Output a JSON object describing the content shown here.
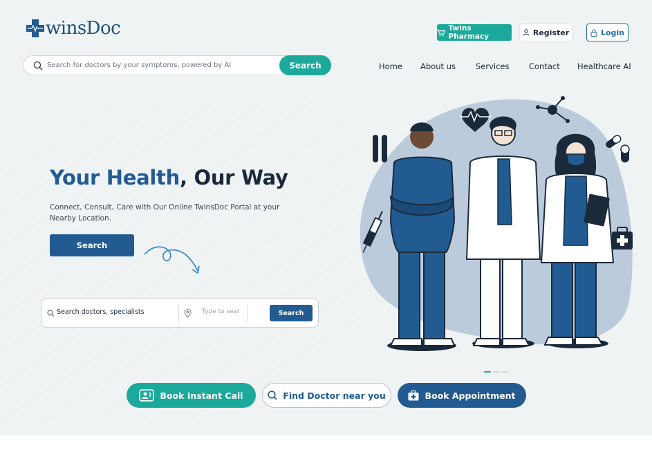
{
  "brand": {
    "name": "winsDoc",
    "accent": "#1aa99a",
    "primary": "#215b91"
  },
  "header": {
    "pharmacy_label": "Twins Pharmacy",
    "register_label": "Register",
    "login_label": "Login"
  },
  "ai_search": {
    "placeholder": "Search for doctors by your symptoms, powered by AI",
    "button_label": "Search"
  },
  "nav": {
    "items": [
      {
        "label": "Home"
      },
      {
        "label": "About us"
      },
      {
        "label": "Services"
      },
      {
        "label": "Contact"
      },
      {
        "label": "Healthcare AI"
      }
    ]
  },
  "hero": {
    "title_part1": "Your Health",
    "title_part2": ", Our Way",
    "subtitle": "Connect, Consult, Care with Our Online TwinsDoc Portal at your Nearby Location.",
    "button_label": "Search"
  },
  "location_search": {
    "query_placeholder": "Search doctors, specialists",
    "location_placeholder": "Type to sear",
    "button_label": "Search"
  },
  "carousel": {
    "slides": 3,
    "active": 1
  },
  "actions": {
    "call_label": "Book Instant Call",
    "find_label": "Find Doctor near you",
    "book_label": "Book Appointment"
  }
}
